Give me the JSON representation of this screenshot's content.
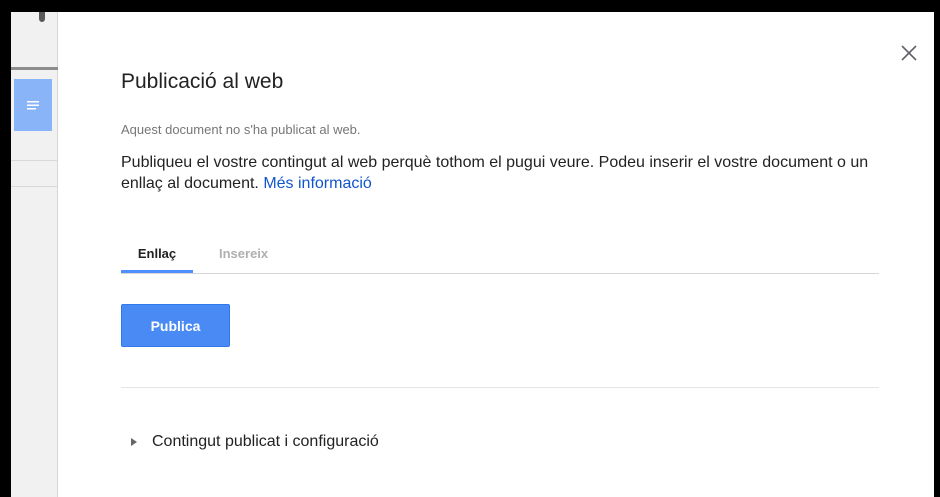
{
  "dialog": {
    "title": "Publicació al web",
    "status": "Aquest document no s'ha publicat al web.",
    "description": "Publiqueu el vostre contingut al web perquè tothom el pugui veure. Podeu inserir el vostre document o un enllaç al document.",
    "more_info_link": "Més informació",
    "close_icon": "close-icon",
    "tabs": [
      {
        "label": "Enllaç",
        "active": true
      },
      {
        "label": "Insereix",
        "active": false
      }
    ],
    "publish_button": "Publica",
    "settings_expander": {
      "label": "Contingut publicat i configuració",
      "icon": "triangle-right-icon",
      "expanded": false
    }
  },
  "colors": {
    "accent": "#4a8af4",
    "link": "#1155cc",
    "tab_indicator": "#4d90fe"
  }
}
